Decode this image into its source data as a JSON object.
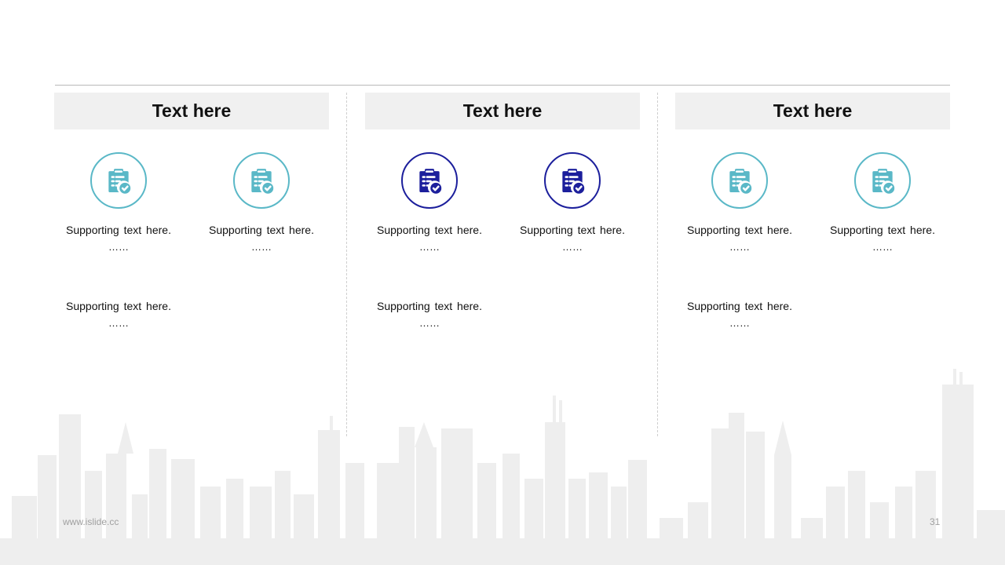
{
  "columns": [
    {
      "title": "Text here",
      "accent": "#5ab8c7",
      "items": [
        {
          "text": "Supporting text here.",
          "dots": "……"
        },
        {
          "text": "Supporting text here.",
          "dots": "……"
        },
        {
          "text": "Supporting text here.",
          "dots": "……"
        }
      ]
    },
    {
      "title": "Text here",
      "accent": "#1c1f9c",
      "items": [
        {
          "text": "Supporting text here.",
          "dots": "……"
        },
        {
          "text": "Supporting text here.",
          "dots": "……"
        },
        {
          "text": "Supporting text here.",
          "dots": "……"
        }
      ]
    },
    {
      "title": "Text here",
      "accent": "#5ab8c7",
      "items": [
        {
          "text": "Supporting text here.",
          "dots": "……"
        },
        {
          "text": "Supporting text here.",
          "dots": "……"
        },
        {
          "text": "Supporting text here.",
          "dots": "……"
        }
      ]
    }
  ],
  "icon": "clipboard-check-icon",
  "footer": {
    "url": "www.islide.cc",
    "page": "31"
  }
}
